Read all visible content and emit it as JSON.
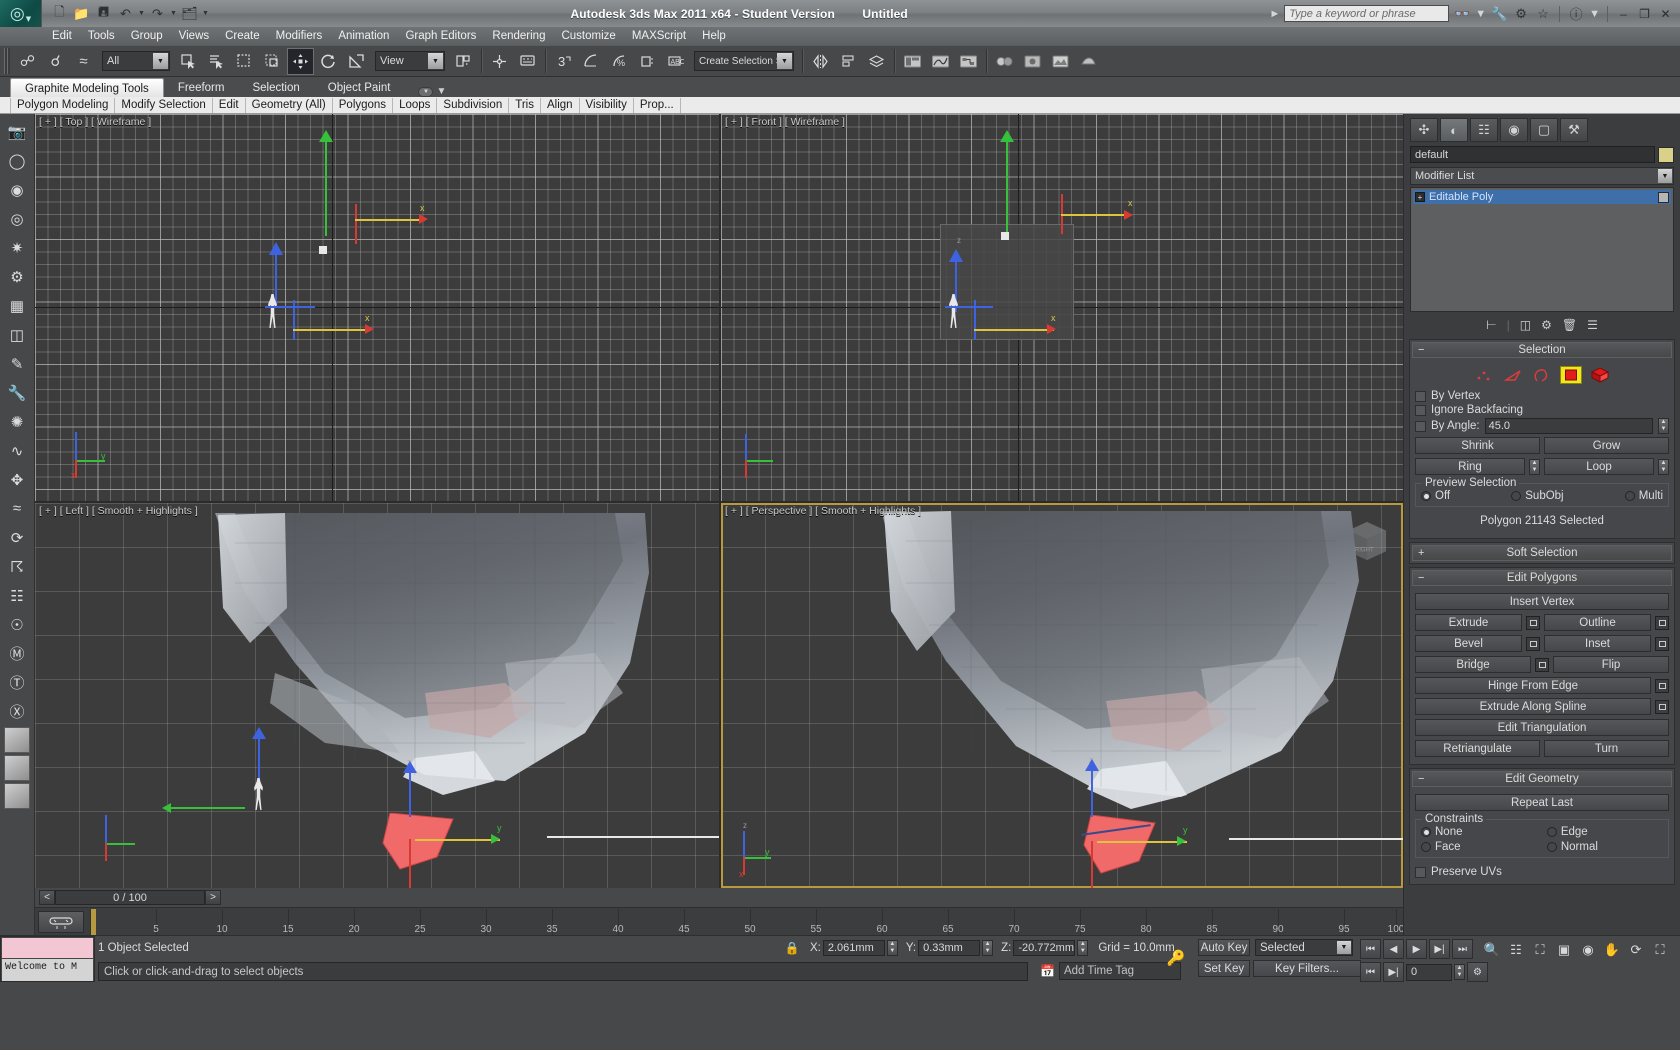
{
  "titlebar": {
    "app_title": "Autodesk 3ds Max  2011 x64  - Student Version",
    "document": "Untitled",
    "search_placeholder": "Type a keyword or phrase",
    "quick_access": [
      "new-file-icon",
      "open-file-icon",
      "save-file-icon",
      "undo-icon",
      "redo-icon",
      "set-project-icon"
    ],
    "help_icons": [
      "binoculars-icon",
      "wrench-icon",
      "compass-icon",
      "star-icon",
      "help-icon"
    ],
    "window_buttons": [
      "minimize",
      "restore",
      "close"
    ]
  },
  "menu": {
    "items": [
      "Edit",
      "Tools",
      "Group",
      "Views",
      "Create",
      "Modifiers",
      "Animation",
      "Graph Editors",
      "Rendering",
      "Customize",
      "MAXScript",
      "Help"
    ]
  },
  "main_toolbar": {
    "selection_filter": "All",
    "reference_coord": "View",
    "named_selection_sets": "Create Selection Se",
    "tooltips": [
      "link-icon",
      "unlink-icon",
      "bind-space-warp-icon",
      "select-object-icon",
      "select-by-name-icon",
      "rectangular-select-region-icon",
      "window-crossing-icon",
      "select-and-move-icon",
      "select-and-rotate-icon",
      "select-and-scale-icon",
      "use-pivot-center-icon",
      "select-and-manipulate-icon",
      "snap-toggle-icon",
      "angle-snap-icon",
      "percent-snap-icon",
      "spinner-snap-icon",
      "edit-named-selection-icon",
      "mirror-icon",
      "align-icon",
      "layer-manager-icon",
      "graphite-toggle-icon",
      "curve-editor-icon",
      "schematic-view-icon",
      "material-editor-icon",
      "render-setup-icon",
      "render-frame-window-icon",
      "render-production-icon"
    ]
  },
  "ribbon": {
    "tabs": [
      {
        "label": "Graphite Modeling Tools",
        "active": true
      },
      {
        "label": "Freeform",
        "active": false
      },
      {
        "label": "Selection",
        "active": false
      },
      {
        "label": "Object Paint",
        "active": false
      }
    ],
    "subtabs": [
      "Polygon Modeling",
      "Modify Selection",
      "Edit",
      "Geometry (All)",
      "Polygons",
      "Loops",
      "Subdivision",
      "Tris",
      "Align",
      "Visibility",
      "Prop..."
    ]
  },
  "left_toolbar": {
    "items": [
      "snapshot-icon",
      "cylinder-icon",
      "sphere-icon",
      "torus-icon",
      "teapot-icon",
      "box-icon",
      "line-icon",
      "pencil-icon",
      "camera-icon",
      "light-icon",
      "helper-icon",
      "spacewarp-icon",
      "systems-icon",
      "array-icon",
      "mirror-tool-icon",
      "align-tool-icon",
      "material-icon",
      "map-icon",
      "render-icon",
      "asset-icon",
      "scene-explorer-icon",
      "zoom-region-icon",
      "render-preview-icon",
      "thumbnail-icon"
    ]
  },
  "viewports": [
    {
      "id": "top-left",
      "label": "[ + ] [ Top ] [ Wireframe ]",
      "active": false,
      "type": "wireframe"
    },
    {
      "id": "top-right",
      "label": "[ + ] [ Front ] [ Wireframe ]",
      "active": false,
      "type": "wireframe"
    },
    {
      "id": "bottom-left",
      "label": "[ + ] [ Left ] [ Smooth + Highlights ]",
      "active": false,
      "type": "shaded"
    },
    {
      "id": "bottom-right",
      "label": "[ + ] [ Perspective ] [ Smooth + Highlights ]",
      "active": true,
      "type": "shaded"
    }
  ],
  "viewcube_label": "RIGHT",
  "command_panel": {
    "tabs": [
      "create-tab-icon",
      "modify-tab-icon",
      "hierarchy-tab-icon",
      "motion-tab-icon",
      "display-tab-icon",
      "utilities-tab-icon"
    ],
    "object_name": "default",
    "modifier_list_label": "Modifier List",
    "stack_items": [
      {
        "label": "Editable Poly"
      }
    ],
    "stack_buttons": [
      "pin-stack-icon",
      "show-end-result-icon",
      "make-unique-icon",
      "remove-modifier-icon",
      "configure-sets-icon"
    ],
    "selection_rollout": {
      "title": "Selection",
      "expanded": true,
      "subobject_icons": [
        "vertex-icon",
        "edge-icon",
        "border-icon",
        "polygon-icon",
        "element-icon"
      ],
      "active_subobject": "polygon-icon",
      "checkboxes": [
        {
          "label": "By Vertex",
          "checked": false
        },
        {
          "label": "Ignore Backfacing",
          "checked": false
        },
        {
          "label": "By Angle:",
          "checked": false
        }
      ],
      "by_angle_value": "45.0",
      "buttons": [
        "Shrink",
        "Grow",
        "Ring",
        "Loop"
      ],
      "preview_group_title": "Preview Selection",
      "preview_options": [
        {
          "label": "Off",
          "selected": true
        },
        {
          "label": "SubObj",
          "selected": false
        },
        {
          "label": "Multi",
          "selected": false
        }
      ],
      "status": "Polygon 21143 Selected"
    },
    "soft_selection_rollout": {
      "title": "Soft Selection",
      "expanded": false
    },
    "edit_polygons_rollout": {
      "title": "Edit Polygons",
      "expanded": true,
      "insert_vertex": "Insert Vertex",
      "pairs": [
        {
          "left": "Extrude",
          "left_settings": true,
          "right": "Outline",
          "right_settings": true
        },
        {
          "left": "Bevel",
          "left_settings": true,
          "right": "Inset",
          "right_settings": true
        },
        {
          "left": "Bridge",
          "left_settings": true,
          "right": "Flip",
          "right_settings": false
        }
      ],
      "wide_buttons": [
        {
          "label": "Hinge From Edge",
          "settings": true
        },
        {
          "label": "Extrude Along Spline",
          "settings": true
        },
        {
          "label": "Edit Triangulation",
          "settings": false
        }
      ],
      "last_pair": {
        "left": "Retriangulate",
        "right": "Turn"
      }
    },
    "edit_geometry_rollout": {
      "title": "Edit Geometry",
      "expanded": true,
      "repeat_last": "Repeat Last",
      "constraints_title": "Constraints",
      "constraints": [
        {
          "label": "None",
          "selected": true
        },
        {
          "label": "Edge",
          "selected": false
        },
        {
          "label": "Face",
          "selected": false
        },
        {
          "label": "Normal",
          "selected": false
        }
      ],
      "preserve_uvs": {
        "label": "Preserve UVs",
        "checked": false
      }
    }
  },
  "time_slider": {
    "prev_label": "<",
    "next_label": ">",
    "current": "0 / 100",
    "track_ticks": [
      5,
      10,
      15,
      20,
      25,
      30,
      35,
      40,
      45,
      50,
      55,
      60,
      65,
      70,
      75,
      80,
      85,
      90,
      95,
      100
    ],
    "key_mode_icon": "key-filter-icon"
  },
  "status_bar": {
    "maxscript_mini_listener": "Welcome to M",
    "selection_status": "1 Object Selected",
    "prompt": "Click or click-and-drag to select objects",
    "lock_icon": "selection-lock-icon",
    "coords": [
      {
        "label": "X:",
        "value": "2.061mm"
      },
      {
        "label": "Y:",
        "value": "0.33mm"
      },
      {
        "label": "Z:",
        "value": "-20.772mm"
      }
    ],
    "grid_text": "Grid = 10.0mm",
    "add_time_tag": "Add Time Tag",
    "key_icon": "key-icon",
    "auto_key": "Auto Key",
    "set_key": "Set Key",
    "key_filters": "Key Filters...",
    "selected_combo": "Selected",
    "frame_value": "0",
    "playback_buttons": [
      "go-to-start-icon",
      "previous-frame-icon",
      "play-icon",
      "next-frame-icon",
      "go-to-end-icon"
    ],
    "nav_buttons": [
      "zoom-icon",
      "zoom-all-icon",
      "zoom-extents-icon",
      "zoom-region-icon",
      "pan-icon",
      "orbit-icon",
      "maximize-viewport-icon"
    ]
  },
  "colors": {
    "accent_yellow": "#b79a3f",
    "selection_red": "#e84c4c",
    "axis_x": "#d63b33",
    "axis_y": "#37c03a",
    "axis_z": "#3f63e0",
    "subobj_highlight": "#f2e71d",
    "stack_selected": "#3f6fa8",
    "panel_bg": "#45474a",
    "toolbar_bg": "#46484a"
  }
}
